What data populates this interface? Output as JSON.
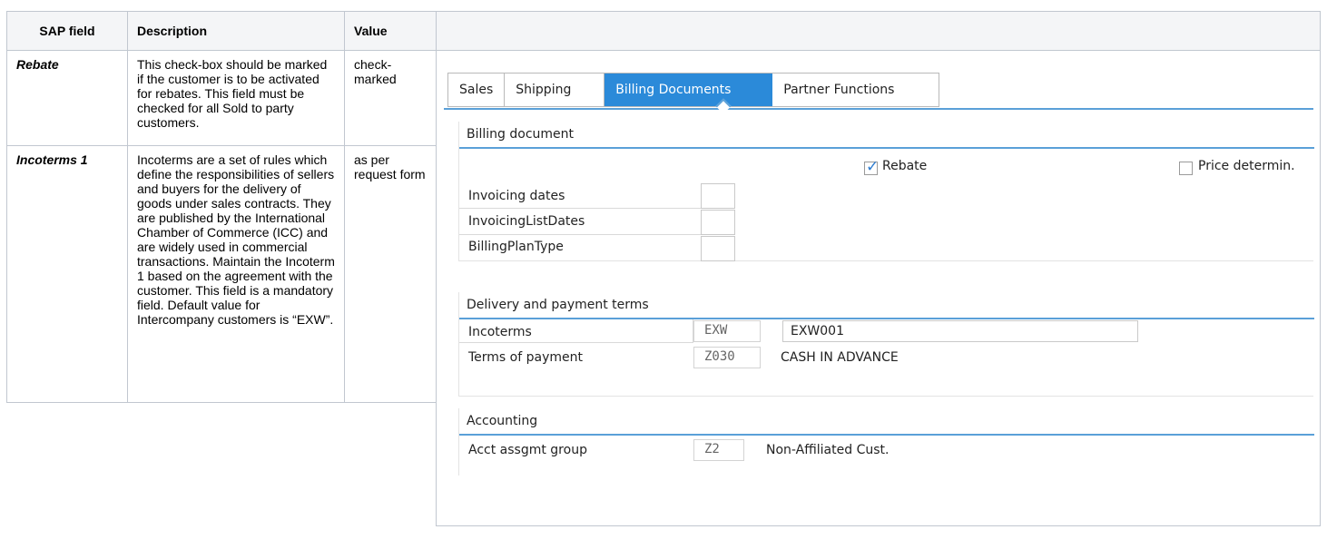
{
  "table": {
    "headers": {
      "field": "SAP field",
      "description": "Description",
      "value": "Value"
    },
    "rows": [
      {
        "field": "Rebate",
        "description": "This check-box should be marked if the customer is to be activated for rebates. This field must be checked for all Sold to party customers.",
        "value": "check-marked"
      },
      {
        "field": "Incoterms 1",
        "description": "Incoterms are a set of rules which define the responsibilities of sellers and buyers for the delivery of goods under sales contracts. They are published by the International Chamber of Commerce (ICC) and are widely used in commercial transactions. Maintain the Incoterm 1 based on the agreement with the customer. This field is a mandatory field. Default value for Intercompany customers is “EXW”.",
        "value": "as per request form"
      }
    ]
  },
  "sap": {
    "tabs": [
      "Sales",
      "Shipping",
      "Billing Documents",
      "Partner Functions"
    ],
    "active_tab": "Billing Documents",
    "billing": {
      "title": "Billing document",
      "rebate_label": "Rebate",
      "rebate_checked": true,
      "price_label": "Price determin.",
      "price_checked": false,
      "invoicing_dates": "Invoicing dates",
      "invoicing_list_dates": "InvoicingListDates",
      "billing_plan_type": "BillingPlanType"
    },
    "delivery": {
      "title": "Delivery and payment terms",
      "incoterms_label": "Incoterms",
      "incoterms_code": "EXW",
      "incoterms_text": "EXW001",
      "terms_label": "Terms of payment",
      "terms_code": "Z030",
      "terms_text": "CASH IN ADVANCE"
    },
    "accounting": {
      "title": "Accounting",
      "acct_label": "Acct assgmt group",
      "acct_code": "Z2",
      "acct_text": "Non-Affiliated Cust."
    },
    "colors": {
      "accent": "#2b8ad9",
      "line": "#5aa0d8"
    }
  }
}
